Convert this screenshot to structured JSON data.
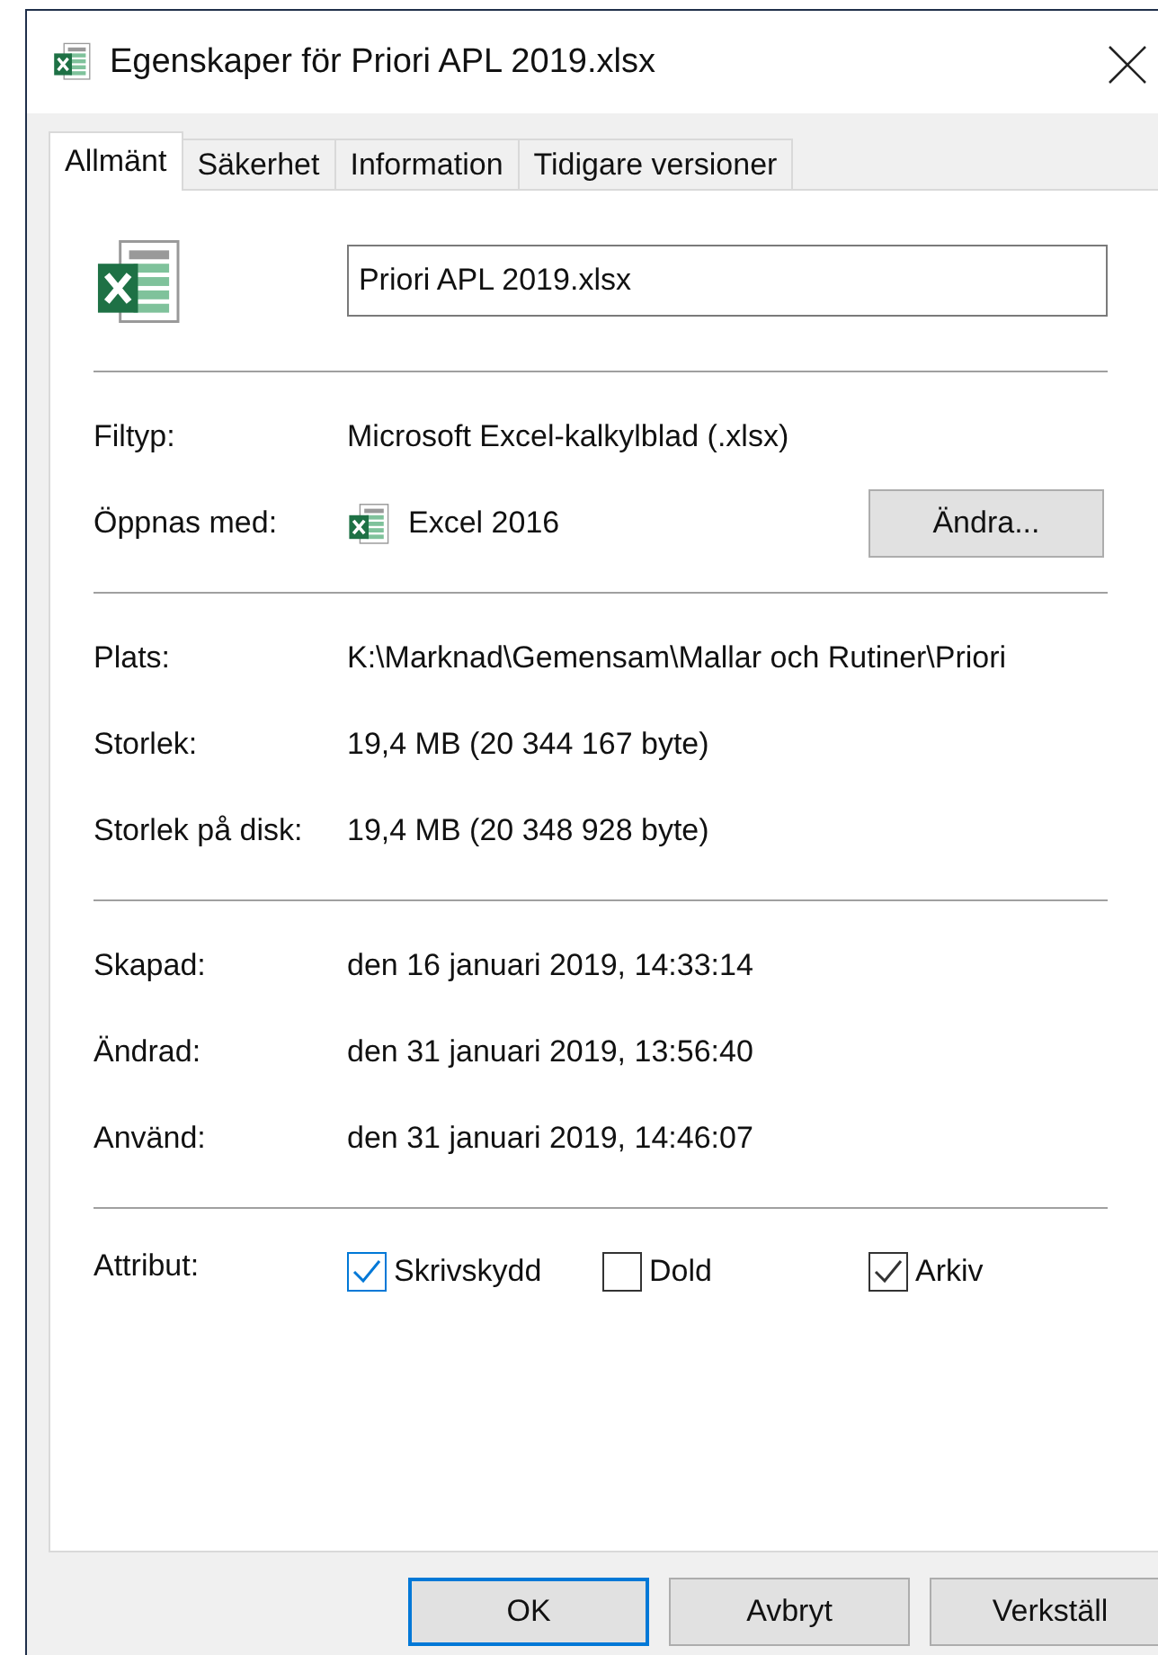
{
  "window": {
    "title": "Egenskaper för Priori APL 2019.xlsx"
  },
  "tabs": [
    {
      "label": "Allmänt",
      "selected": true
    },
    {
      "label": "Säkerhet",
      "selected": false
    },
    {
      "label": "Information",
      "selected": false
    },
    {
      "label": "Tidigare versioner",
      "selected": false
    }
  ],
  "file_name": {
    "value": "Priori APL 2019.xlsx"
  },
  "sections": [
    {
      "rows": [
        {
          "label": "Filtyp:",
          "value": "Microsoft Excel-kalkylblad (.xlsx)"
        },
        {
          "label": "Öppnas med:",
          "value": "Excel 2016",
          "kind": "app",
          "button": "Ändra..."
        }
      ]
    },
    {
      "rows": [
        {
          "label": "Plats:",
          "value": "K:\\Marknad\\Gemensam\\Mallar och Rutiner\\Priori"
        },
        {
          "label": "Storlek:",
          "value": "19,4 MB (20 344 167 byte)"
        },
        {
          "label": "Storlek på disk:",
          "value": "19,4 MB (20 348 928 byte)"
        }
      ]
    },
    {
      "rows": [
        {
          "label": "Skapad:",
          "value": "den 16 januari 2019, 14:33:14"
        },
        {
          "label": "Ändrad:",
          "value": "den 31 januari 2019, 13:56:40"
        },
        {
          "label": "Använd:",
          "value": "den 31 januari 2019, 14:46:07"
        }
      ]
    }
  ],
  "attributes": {
    "label": "Attribut:",
    "items": [
      {
        "label": "Skrivskydd",
        "checked": true,
        "focused": true
      },
      {
        "label": "Dold",
        "checked": false,
        "focused": false
      },
      {
        "label": "Arkiv",
        "checked": true,
        "focused": false
      }
    ]
  },
  "buttons": [
    {
      "label": "OK",
      "default": true
    },
    {
      "label": "Avbryt",
      "default": false
    },
    {
      "label": "Verkställ",
      "default": false
    }
  ]
}
